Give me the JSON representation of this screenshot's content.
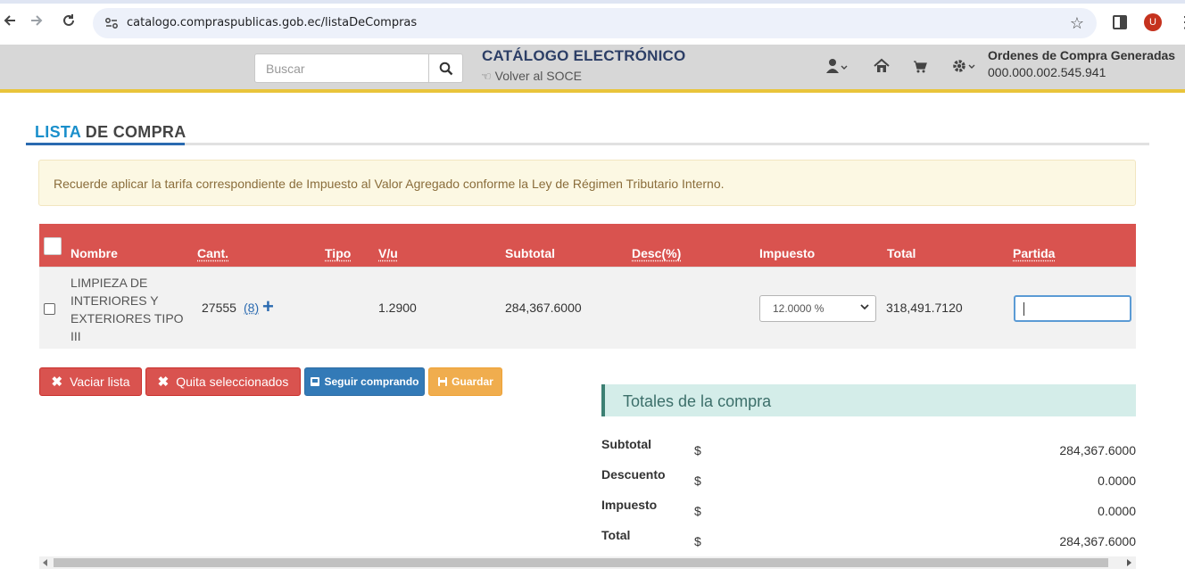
{
  "browser": {
    "url": "catalogo.compraspublicas.gob.ec/listaDeCompras",
    "profile_initial": "U",
    "icons": [
      "back-icon",
      "forward-icon",
      "reload-icon",
      "site-settings-icon",
      "bookmark-star-icon",
      "side-panel-icon",
      "kebab-menu-icon"
    ]
  },
  "header": {
    "search_placeholder": "Buscar",
    "title": "CATÁLOGO ELECTRÓNICO",
    "back_link": "Volver al SOCE",
    "orders_title": "Ordenes de Compra Generadas",
    "orders_value": "000.000.002.545.941",
    "icons": [
      "user-icon",
      "home-icon",
      "cart-icon",
      "gear-icon"
    ]
  },
  "page": {
    "title_accent": "LISTA",
    "title_rest": " DE COMPRA"
  },
  "alert": {
    "text": "Recuerde aplicar la tarifa correspondiente de Impuesto al Valor Agregado conforme la Ley de Régimen Tributario Interno."
  },
  "table": {
    "headers": {
      "nombre": "Nombre",
      "cant": "Cant.",
      "tipo": "Tipo",
      "vu": "V/u",
      "subtotal": "Subtotal",
      "desc": "Desc(%)",
      "impuesto": "Impuesto",
      "total": "Total",
      "partida": "Partida"
    },
    "rows": [
      {
        "nombre": "LIMPIEZA DE INTERIORES Y EXTERIORES TIPO III",
        "cant": "27555",
        "cant_link": "(8)",
        "tipo": "",
        "vu": "1.2900",
        "subtotal": "284,367.6000",
        "desc": "",
        "impuesto": "12.0000 %",
        "total": "318,491.7120",
        "partida": ""
      }
    ]
  },
  "buttons": {
    "vaciar": "Vaciar lista",
    "quitar": "Quita seleccionados",
    "seguir": "Seguir comprando",
    "guardar": "Guardar"
  },
  "totals": {
    "heading": "Totales de la compra",
    "currency": "$",
    "rows": [
      {
        "label": "Subtotal",
        "value": "284,367.6000"
      },
      {
        "label": "Descuento",
        "value": "0.0000"
      },
      {
        "label": "Impuesto",
        "value": "0.0000"
      },
      {
        "label": "Total",
        "value": "284,367.6000"
      }
    ]
  },
  "colors": {
    "table_header": "#d9534f",
    "accent_blue": "#1a8fcb",
    "header_bg": "#d7d7d7",
    "header_border": "#e9c43b",
    "alert_bg": "#fcf8e3",
    "totals_bg": "#d4ede9"
  }
}
